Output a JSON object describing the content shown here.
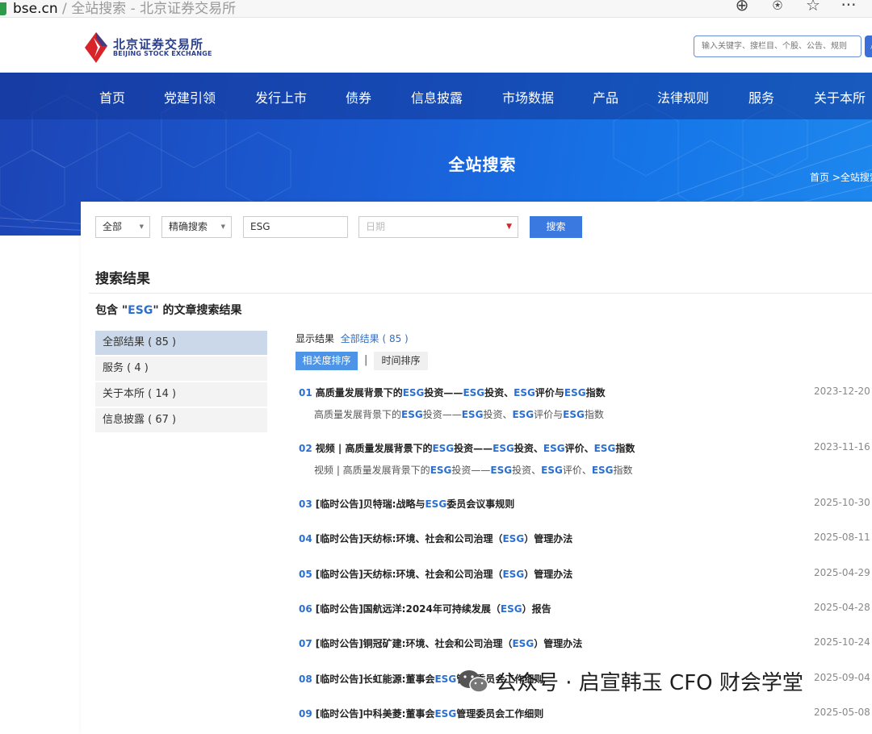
{
  "browser": {
    "host": "bse.cn",
    "sep": " / ",
    "tab_title": "全站搜索 - 北京证券交易所"
  },
  "header": {
    "logo_cn": "北京证券交易所",
    "logo_en": "BEIJING STOCK EXCHANGE",
    "search_placeholder": "输入关键字、搜栏目、个股、公告、规则"
  },
  "nav": [
    "首页",
    "党建引领",
    "发行上市",
    "债券",
    "信息披露",
    "市场数据",
    "产品",
    "法律规则",
    "服务",
    "关于本所"
  ],
  "banner": {
    "title": "全站搜索",
    "breadcrumb": "首页 >全站搜索"
  },
  "filters": {
    "scope": "全部",
    "mode": "精确搜索",
    "keyword": "ESG",
    "date_placeholder": "日期",
    "search_label": "搜索"
  },
  "results": {
    "heading": "搜索结果",
    "sub_prefix": "包含 \"",
    "sub_keyword": "ESG",
    "sub_suffix": "\" 的文章搜索结果",
    "categories": [
      {
        "label": "全部结果 ( 85 )"
      },
      {
        "label": "服务 ( 4 )"
      },
      {
        "label": "关于本所 ( 14 )"
      },
      {
        "label": "信息披露 ( 67 )"
      }
    ],
    "showing_label": "显示结果",
    "showing_value": "全部结果 ( 85 )",
    "sort_relevance": "相关度排序",
    "sort_sep": "|",
    "sort_time": "时间排序",
    "items": [
      {
        "num": "01",
        "title": "高质量发展背景下的ESG投资——ESG投资、ESG评价与ESG指数",
        "desc": "高质量发展背景下的ESG投资——ESG投资、ESG评价与ESG指数",
        "date": "2023-12-20"
      },
      {
        "num": "02",
        "title": "视频 | 高质量发展背景下的ESG投资——ESG投资、ESG评价、ESG指数",
        "desc": "视频 | 高质量发展背景下的ESG投资——ESG投资、ESG评价、ESG指数",
        "date": "2023-11-16"
      },
      {
        "num": "03",
        "title": "[临时公告]贝特瑞:战略与ESG委员会议事规则",
        "date": "2025-10-30"
      },
      {
        "num": "04",
        "title": "[临时公告]天纺标:环境、社会和公司治理（ESG）管理办法",
        "date": "2025-08-11"
      },
      {
        "num": "05",
        "title": "[临时公告]天纺标:环境、社会和公司治理（ESG）管理办法",
        "date": "2025-04-29"
      },
      {
        "num": "06",
        "title": "[临时公告]国航远洋:2024年可持续发展（ESG）报告",
        "date": "2025-04-28"
      },
      {
        "num": "07",
        "title": "[临时公告]铜冠矿建:环境、社会和公司治理（ESG）管理办法",
        "date": "2025-10-24"
      },
      {
        "num": "08",
        "title": "[临时公告]长虹能源:董事会ESG管理委员会工作细则",
        "date": "2025-09-04"
      },
      {
        "num": "09",
        "title": "[临时公告]中科美菱:董事会ESG管理委员会工作细则",
        "date": "2025-05-08"
      }
    ]
  },
  "watermark": "公众号 · 启宣韩玉 CFO 财会学堂",
  "colors": {
    "accent": "#2a6fd1",
    "nav_bg": "#1c44b5",
    "button": "#3a79e0",
    "logo_red": "#d9232a"
  }
}
